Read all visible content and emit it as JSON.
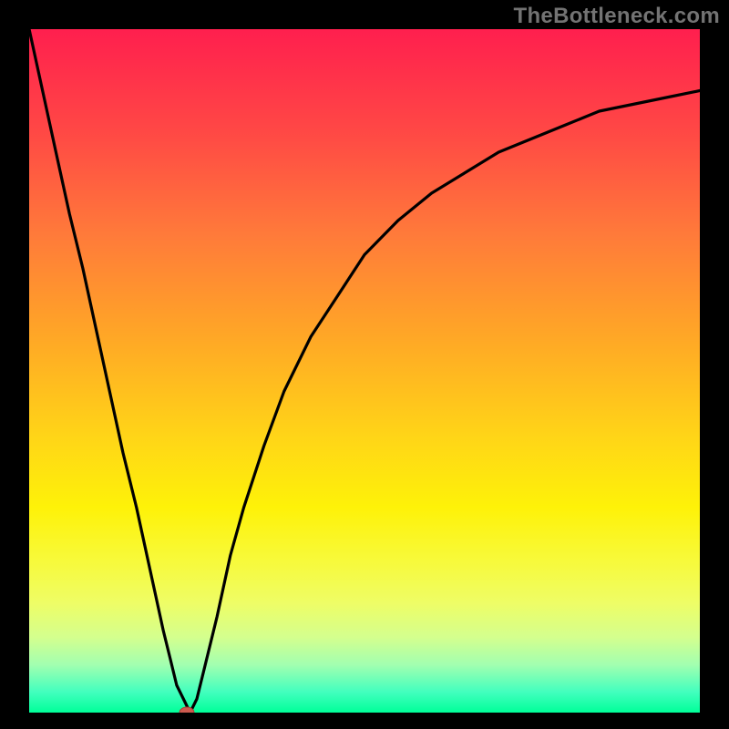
{
  "chart_data": {
    "type": "line",
    "title": "",
    "xlabel": "",
    "ylabel": "",
    "xlim": [
      0,
      100
    ],
    "ylim": [
      0,
      100
    ],
    "x": [
      0,
      2,
      4,
      6,
      8,
      10,
      12,
      14,
      16,
      18,
      20,
      21,
      22,
      23,
      24,
      25,
      26,
      28,
      30,
      32,
      35,
      38,
      42,
      46,
      50,
      55,
      60,
      65,
      70,
      75,
      80,
      85,
      90,
      95,
      100
    ],
    "values": [
      100,
      91,
      82,
      73,
      65,
      56,
      47,
      38,
      30,
      21,
      12,
      8,
      4,
      2,
      0,
      2,
      6,
      14,
      23,
      30,
      39,
      47,
      55,
      61,
      67,
      72,
      76,
      79,
      82,
      84,
      86,
      88,
      89,
      90,
      91
    ],
    "marker": {
      "x": 23.5,
      "y": 0,
      "color": "#cc5a4f"
    },
    "background": "rainbow-vertical-gradient",
    "frame": "black"
  },
  "watermark": "TheBottleneck.com"
}
